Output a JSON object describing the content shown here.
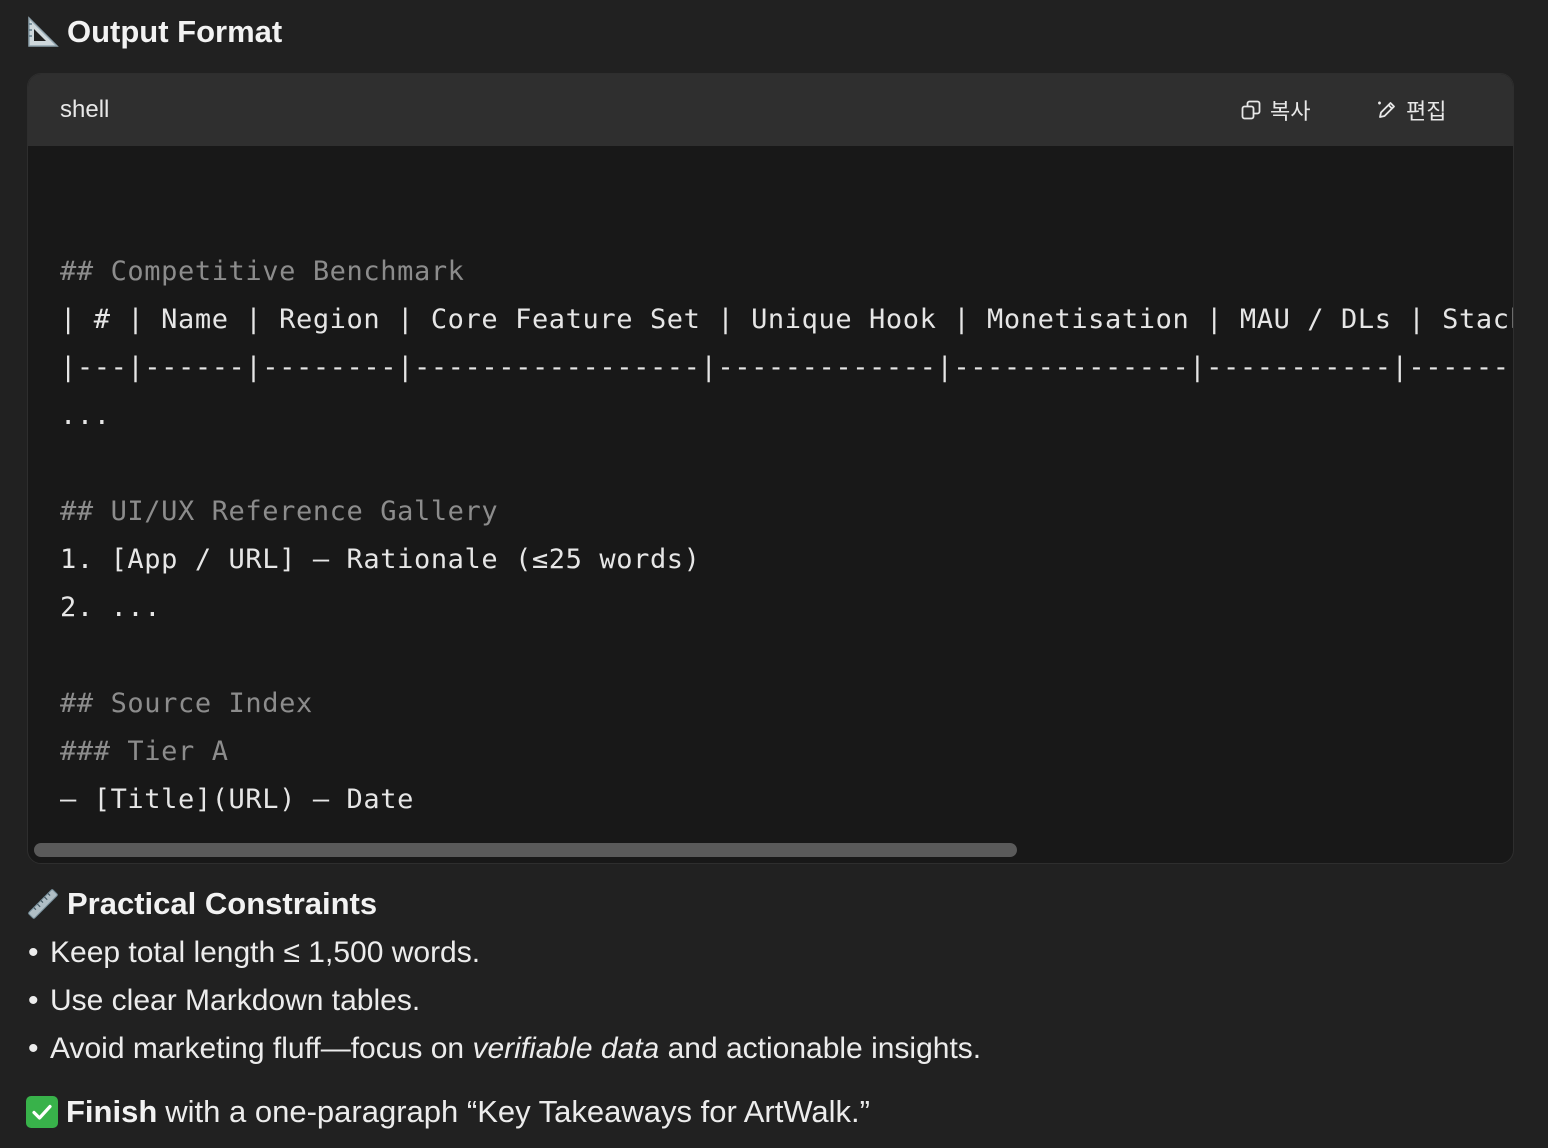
{
  "output_format": {
    "icon": "triangular-ruler-icon",
    "title": "Output Format"
  },
  "code_block": {
    "language": "shell",
    "copy_label": "복사",
    "edit_label": "편집",
    "lines": [
      "## Competitive Benchmark",
      "| # | Name | Region | Core Feature Set | Unique Hook | Monetisation | MAU / DLs | Stack",
      "|---|------|--------|-----------------|-------------|--------------|-----------|------------",
      "...",
      "## UI/UX Reference Gallery",
      "1. [App / URL] — Rationale (≤25 words)",
      "2. ...",
      "## Source Index",
      "### Tier A",
      "– [Title](URL) – Date",
      "..."
    ]
  },
  "practical_constraints": {
    "icon": "straight-ruler-icon",
    "title": "Practical Constraints",
    "bullet_char": "•",
    "items": [
      "Keep total length ≤ 1,500 words.",
      "Use clear Markdown tables."
    ],
    "item3": {
      "before": "Avoid marketing fluff—focus on ",
      "emphasis": "verifiable data",
      "after": " and actionable insights."
    }
  },
  "finish": {
    "icon": "check-mark-button-icon",
    "bold": "Finish",
    "rest": "with a one-paragraph “Key Takeaways for ArtWalk.”"
  },
  "colors": {
    "background": "#212121",
    "code_background": "#181818",
    "header_background": "#2f2f2f",
    "comment_text": "#8c8c8c",
    "check_green": "#38b24a"
  }
}
